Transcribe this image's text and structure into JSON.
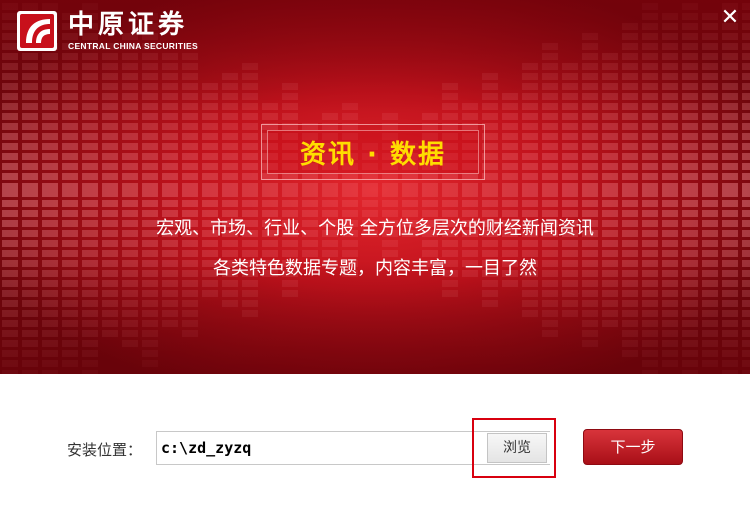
{
  "brand": {
    "name_cn": "中原证券",
    "name_en": "CENTRAL CHINA SECURITIES"
  },
  "window": {
    "close_glyph": "✕"
  },
  "banner": {
    "title": "资讯 · 数据",
    "subtitle_line1": "宏观、市场、行业、个股 全方位多层次的财经新闻资讯",
    "subtitle_line2": "各类特色数据专题，内容丰富，一目了然",
    "title_color": "#ffdd00",
    "background_color": "#c0121c"
  },
  "install": {
    "label": "安装位置：",
    "path_value": "c:\\zd_zyzq",
    "browse_label": "浏览",
    "next_label": "下一步",
    "highlight_color": "#d8000f"
  },
  "icons": {
    "logo": "brand-logo-icon",
    "close": "close-icon"
  }
}
